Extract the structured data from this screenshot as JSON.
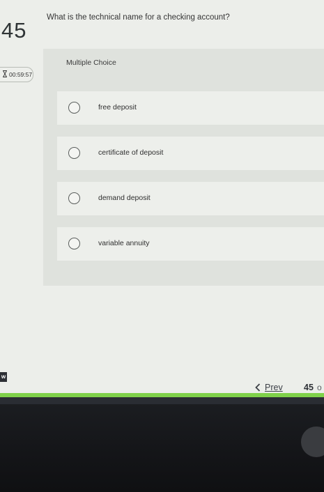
{
  "question": {
    "number": "45",
    "text": "What is the technical name for a checking account?",
    "type": "Multiple Choice"
  },
  "timer": {
    "icon": "hourglass-icon",
    "value": "00:59:57"
  },
  "options": [
    {
      "label": "free deposit",
      "selected": false
    },
    {
      "label": "certificate of deposit",
      "selected": false
    },
    {
      "label": "demand deposit",
      "selected": false
    },
    {
      "label": "variable annuity",
      "selected": false
    }
  ],
  "footer": {
    "corner_text": "w",
    "prev_label": "Prev",
    "page_number": "45",
    "page_suffix": "o"
  },
  "colors": {
    "accent_bar": "#7fd14a",
    "bezel": "#141518"
  }
}
